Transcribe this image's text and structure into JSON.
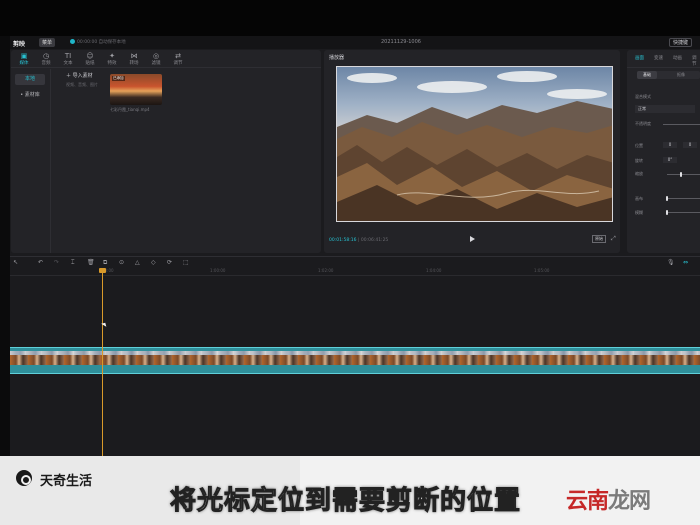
{
  "titlebar": {
    "app_name": "剪映",
    "menu_label": "菜单",
    "autosave": "00:00:00 自动保存本地",
    "project_name": "20211129-1006",
    "shortcut_label": "快捷键"
  },
  "media": {
    "tabs": [
      {
        "icon": "▣",
        "label": "媒体"
      },
      {
        "icon": "◷",
        "label": "音频"
      },
      {
        "icon": "TI",
        "label": "文本"
      },
      {
        "icon": "☺",
        "label": "贴纸"
      },
      {
        "icon": "✦",
        "label": "特效"
      },
      {
        "icon": "⋈",
        "label": "转场"
      },
      {
        "icon": "◎",
        "label": "滤镜"
      },
      {
        "icon": "⇄",
        "label": "调节"
      }
    ],
    "sidebar": [
      {
        "label": "本地"
      },
      {
        "label": "• 素材库"
      }
    ],
    "import_label": "导入素材",
    "import_hint": "视频、音频、图片",
    "clip_tag": "已添加",
    "clip_name": "七彩丹霞_tianqi.mp4"
  },
  "player": {
    "title": "播放器",
    "current_time": "00:01:58:16",
    "total_time": "00:06:41:25",
    "ratio_label": "原始"
  },
  "props": {
    "tabs": [
      "画面",
      "变速",
      "动画",
      "调节"
    ],
    "subtabs": [
      "基础",
      "抠像"
    ],
    "blend_label": "混合模式",
    "blend_value": "正常",
    "opacity_label": "不透明度",
    "position_label": "位置",
    "position_x": "0",
    "position_y": "0",
    "rotate_label": "旋转",
    "rotate_value": "0°",
    "scale_label": "缩放",
    "zoom_label": "画布",
    "blur_label": "模糊"
  },
  "timeline": {
    "tools": [
      "↖",
      "↶",
      "↷",
      "⌶",
      "🗑",
      "⧉",
      "⊙",
      "△",
      "◇",
      "⟳",
      "⬚"
    ],
    "ruler": [
      "00:00",
      "1:00:00",
      "1:02:00",
      "1:04:00",
      "1:05:00"
    ]
  },
  "watermark": {
    "brand": "天奇生活",
    "subtitle": "将光标定位到需要剪断的位置",
    "site_red": "云南",
    "site_gray": "龙网"
  }
}
